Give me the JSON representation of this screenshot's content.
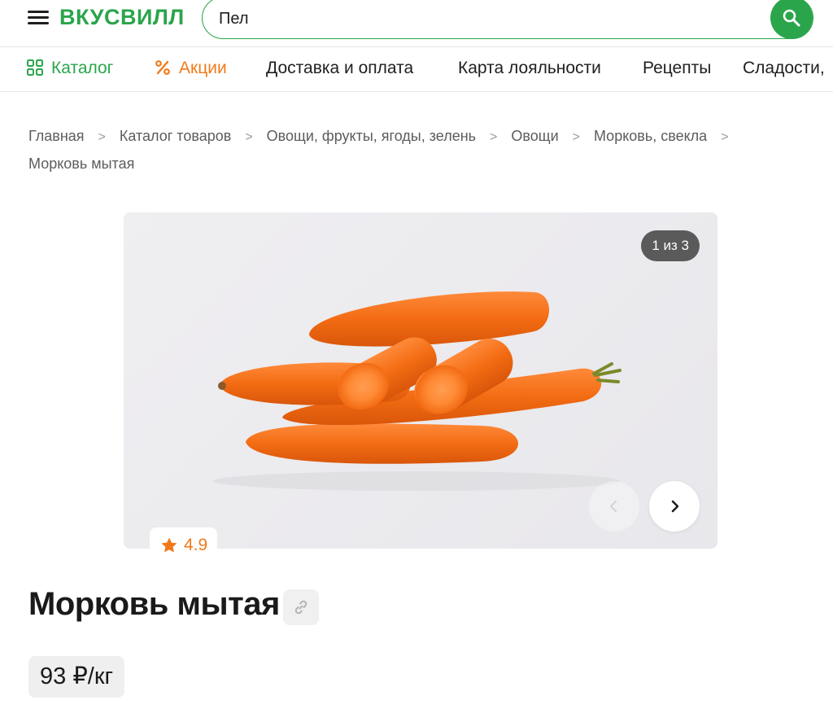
{
  "header": {
    "logo": "ВКУСВИЛЛ",
    "search_value": "Пел",
    "search_icon": "search-icon",
    "menu_icon": "hamburger-menu-icon"
  },
  "nav": {
    "items": [
      {
        "label": "Каталог",
        "icon": "grid-icon",
        "color": "#2aa54b"
      },
      {
        "label": "Акции",
        "icon": "percent-icon",
        "color": "#f07a1a"
      },
      {
        "label": "Доставка и оплата"
      },
      {
        "label": "Карта лояльности"
      },
      {
        "label": "Рецепты"
      },
      {
        "label": "Сладости,"
      }
    ]
  },
  "breadcrumbs": [
    "Главная",
    "Каталог товаров",
    "Овощи, фрукты, ягоды, зелень",
    "Овощи",
    "Морковь, свекла",
    "Морковь мытая"
  ],
  "gallery": {
    "counter": "1 из 3",
    "rating": "4.9",
    "rating_icon": "star-icon"
  },
  "product": {
    "title": "Морковь мытая",
    "price": "93 ₽/кг",
    "link_icon": "link-icon"
  },
  "colors": {
    "brand_green": "#2aa54b",
    "accent_orange": "#f07a1a"
  }
}
